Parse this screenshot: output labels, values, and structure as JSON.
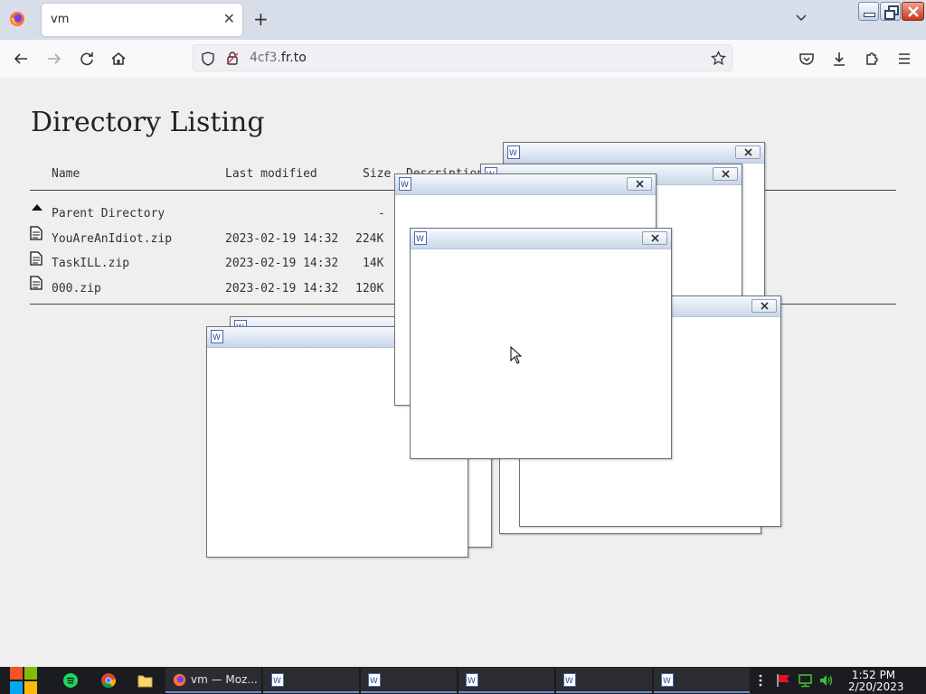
{
  "browser": {
    "tab_title": "vm",
    "tab_close_glyph": "✕",
    "new_tab_glyph": "+",
    "url_host_prefix": "4cf3.",
    "url_host_main": "fr.to"
  },
  "page": {
    "title": "Directory Listing",
    "columns": [
      "Name",
      "Last modified",
      "Size",
      "Description"
    ],
    "parent": {
      "name": "Parent Directory",
      "size": "-"
    },
    "files": [
      {
        "name": "YouAreAnIdiot.zip",
        "modified": "2023-02-19 14:32",
        "size": "224K"
      },
      {
        "name": "TaskILL.zip",
        "modified": "2023-02-19 14:32",
        "size": "14K"
      },
      {
        "name": "000.zip",
        "modified": "2023-02-19 14:32",
        "size": "120K"
      }
    ]
  },
  "taskbar": {
    "firefox_task_label": "vm — Moz...",
    "clock_time": "1:52 PM",
    "clock_date": "2/20/2023"
  },
  "icons": {
    "browser": [
      "firefox-logo-icon",
      "back-icon",
      "forward-icon",
      "reload-icon",
      "home-icon",
      "shield-icon",
      "lock-icon",
      "bookmark-star-icon",
      "pocket-icon",
      "download-icon",
      "extensions-icon",
      "menu-icon"
    ],
    "taskbar": [
      "windows-start-icon",
      "spotify-icon",
      "chrome-icon",
      "file-explorer-icon",
      "firefox-icon",
      "wordpad-icon"
    ],
    "tray": [
      "flag-icon",
      "network-icon",
      "volume-icon"
    ]
  },
  "colors": {
    "accent": "#6b8bd6",
    "titlebar": "#c9d6e8",
    "taskbar": "#1b1c1f"
  }
}
